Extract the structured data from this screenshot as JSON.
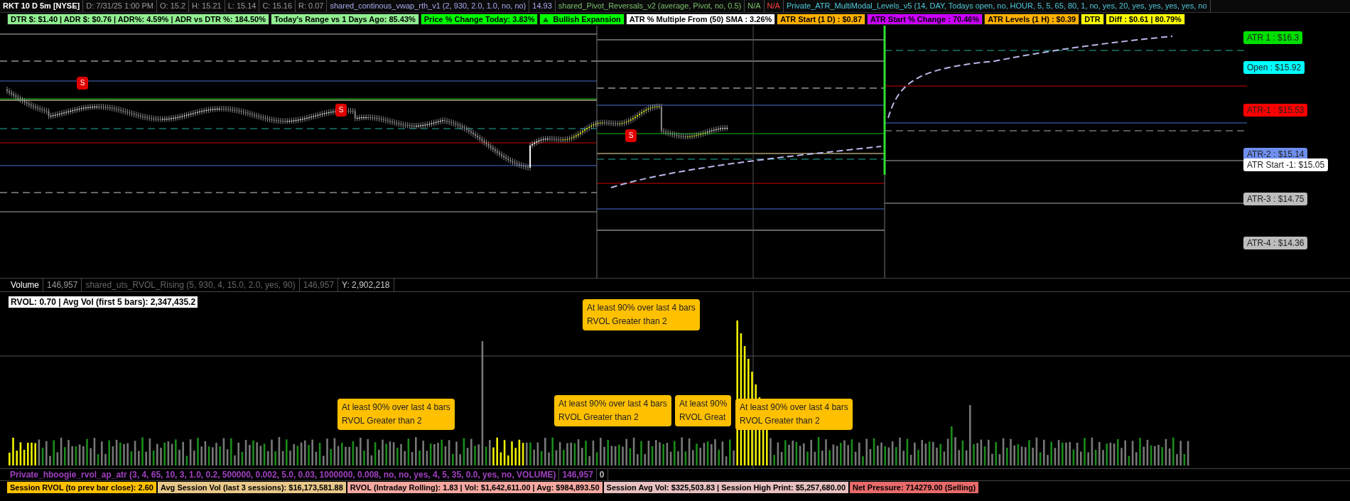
{
  "title_bar": [
    {
      "text": "RKT 10 D 5m [NYSE]",
      "color": "#ffffff"
    },
    {
      "text": "D: 7/31/25 1:00 PM",
      "color": "#9a9a9a"
    },
    {
      "text": "O: 15.2",
      "color": "#9a9a9a"
    },
    {
      "text": "H: 15.21",
      "color": "#9a9a9a"
    },
    {
      "text": "L: 15.14",
      "color": "#9a9a9a"
    },
    {
      "text": "C: 15.16",
      "color": "#9a9a9a"
    },
    {
      "text": "R: 0.07",
      "color": "#9a9a9a"
    },
    {
      "text": "shared_continous_vwap_rth_v1 (2, 930, 2.0, 1.0, no, no)",
      "color": "#aaaaee"
    },
    {
      "text": "14.93",
      "color": "#aaaaee"
    },
    {
      "text": "shared_Pivot_Reversals_v2 (average, Pivot, no, 0.5)",
      "color": "#7cc06c"
    },
    {
      "text": "N/A",
      "color": "#7cc06c"
    },
    {
      "text": "N/A",
      "color": "#ff4040"
    },
    {
      "text": "Private_ATR_MultiModal_Levels_v5 (14, DAY, Todays open, no, HOUR, 5, 5, 65, 80, 1, no, yes, 20, yes, yes, yes, yes, no",
      "color": "#4fc8d8"
    }
  ],
  "badges": [
    {
      "kind": "text",
      "text": "DTR $: $1.40 | ADR $: $0.76 | ADR%: 4.59% | ADR vs DTR %: 184.50%",
      "color": "#90ee90"
    },
    {
      "kind": "text",
      "text": "Today's Range vs 1 Days Ago: 85.43%",
      "color": "#90ee90"
    },
    {
      "kind": "text",
      "text": "Price % Change Today: 3.83%",
      "color": "#00ff00"
    },
    {
      "kind": "signal",
      "text": "Bullish Expansion",
      "color": "#00ff00"
    },
    {
      "kind": "text",
      "text": "ATR % Multiple From (50) SMA : 3.26%",
      "color": "#ffffff"
    },
    {
      "kind": "text",
      "text": "ATR Start (1 D) : $0.87",
      "color": "#ffb000"
    },
    {
      "kind": "text",
      "text": "ATR Start % Change : 70.46%",
      "color": "#cc00ff"
    },
    {
      "kind": "text",
      "text": "ATR Levels (1 H) : $0.39",
      "color": "#ffb000"
    },
    {
      "kind": "text",
      "text": "DTR",
      "color": "#ffff00"
    },
    {
      "kind": "text",
      "text": "Diff : $0.61 | 80.79%",
      "color": "#ffff00"
    }
  ],
  "price_levels": [
    {
      "label": "ATR 1 : $16.3",
      "color": "#00e000"
    },
    {
      "label": "Open : $15.92",
      "color": "#00ffff"
    },
    {
      "label": "ATR-1 : $15.53",
      "color": "#ff0000"
    },
    {
      "label": "ATR-2 : $15.14",
      "color": "#6f8ff0"
    },
    {
      "label": "ATR Start -1: $15.05",
      "color": "#ffffff"
    },
    {
      "label": "ATR-3 : $14.75",
      "color": "#bdbdbd"
    },
    {
      "label": "ATR-4 : $14.36",
      "color": "#bdbdbd"
    }
  ],
  "signal_markers": [
    "S",
    "S",
    "S"
  ],
  "volume_header": [
    {
      "text": "Volume",
      "color": "#ffffff"
    },
    {
      "text": "146,957",
      "color": "#9a9a9a"
    },
    {
      "text": "shared_uts_RVOL_Rising (5, 930, 4, 15.0, 2.0, yes, 90)",
      "color": "#666666"
    },
    {
      "text": "146,957",
      "color": "#666666"
    },
    {
      "text": "Y: 2,902,218",
      "color": "#cccccc"
    }
  ],
  "rvol_label": "RVOL: 0.70 | Avg Vol (first 5 bars): 2,347,435.2",
  "callouts": [
    [
      "At least 90% over last 4 bars",
      "RVOL Greater than 2"
    ],
    [
      "At least 90% over last 4 bars",
      "RVOL Greater than 2"
    ],
    [
      "At least 90% over last 4 bars",
      "RVOL Greater than 2"
    ],
    [
      "At least 90%",
      "RVOL Great"
    ],
    [
      "At least 90% over last 4 bars",
      "RVOL Greater than 2"
    ]
  ],
  "study_bar": [
    {
      "text": "Private_hboogie_rvol_ap_atr (3, 4, 65, 10, 3, 1.0, 0.2, 500000, 0.002, 5.0, 0.03, 1000000, 0.008, no, no, yes, 4, 5, 35, 0.0, yes, no, VOLUME)",
      "color": "#a040c0"
    },
    {
      "text": "146,957",
      "color": "#a040c0"
    },
    {
      "text": "0",
      "color": "#bbbbbb"
    }
  ],
  "stats_bar": [
    {
      "text": "Session RVOL (to prev bar close): 2.60",
      "color": "#ffc000"
    },
    {
      "text": "Avg Session Vol (last 3 sessions): $16,173,581.88",
      "color": "#e8c88a"
    },
    {
      "text": "RVOL (Intraday Rolling): 1.83 | Vol: $1,642,611.00 | Avg: $984,893.50",
      "color": "#f4a8a0"
    },
    {
      "text": "Session Avg Vol: $325,503.83 | Session High Print: $5,257,680.00",
      "color": "#e8c0c0"
    },
    {
      "text": "Net Pressure: 714279.00 (Selling)",
      "color": "#e86a6a"
    }
  ]
}
